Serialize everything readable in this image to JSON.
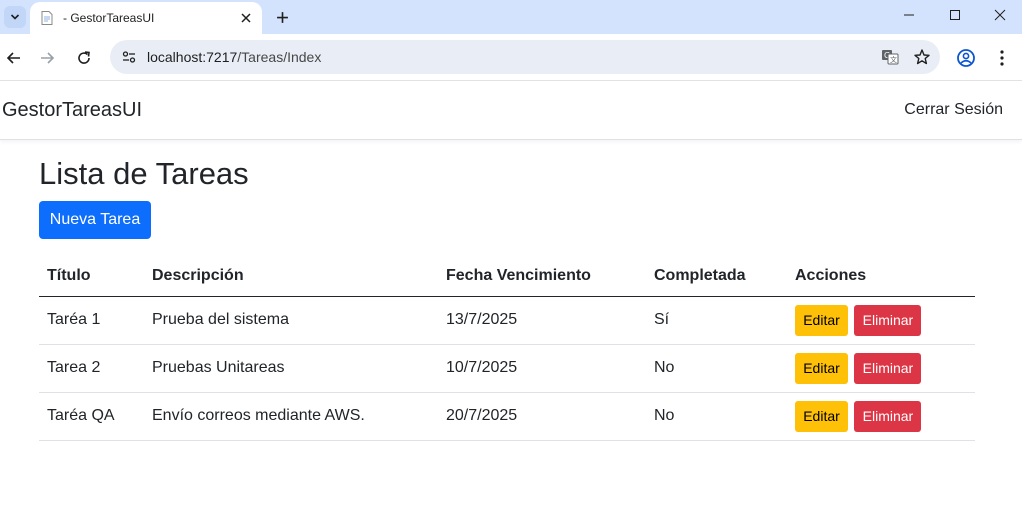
{
  "browser": {
    "tab_title": "- GestorTareasUI",
    "url_host": "localhost:7217",
    "url_path": "/Tareas/Index"
  },
  "navbar": {
    "brand": "GestorTareasUI",
    "logout": "Cerrar Sesión"
  },
  "main": {
    "title": "Lista de Tareas",
    "new_button": "Nueva Tarea",
    "table": {
      "headers": [
        "Título",
        "Descripción",
        "Fecha Vencimiento",
        "Completada",
        "Acciones"
      ],
      "rows": [
        {
          "titulo": "Taréa 1",
          "descripcion": "Prueba del sistema",
          "fecha": "13/7/2025",
          "completada": "Sí"
        },
        {
          "titulo": "Tarea 2",
          "descripcion": "Pruebas Unitareas",
          "fecha": "10/7/2025",
          "completada": "No"
        },
        {
          "titulo": "Taréa QA",
          "descripcion": "Envío correos mediante AWS.",
          "fecha": "20/7/2025",
          "completada": "No"
        }
      ],
      "edit_label": "Editar",
      "delete_label": "Eliminar"
    }
  },
  "colors": {
    "primary": "#0d6efd",
    "warning": "#ffc107",
    "danger": "#dc3545",
    "tabstrip": "#d3e3fd"
  }
}
